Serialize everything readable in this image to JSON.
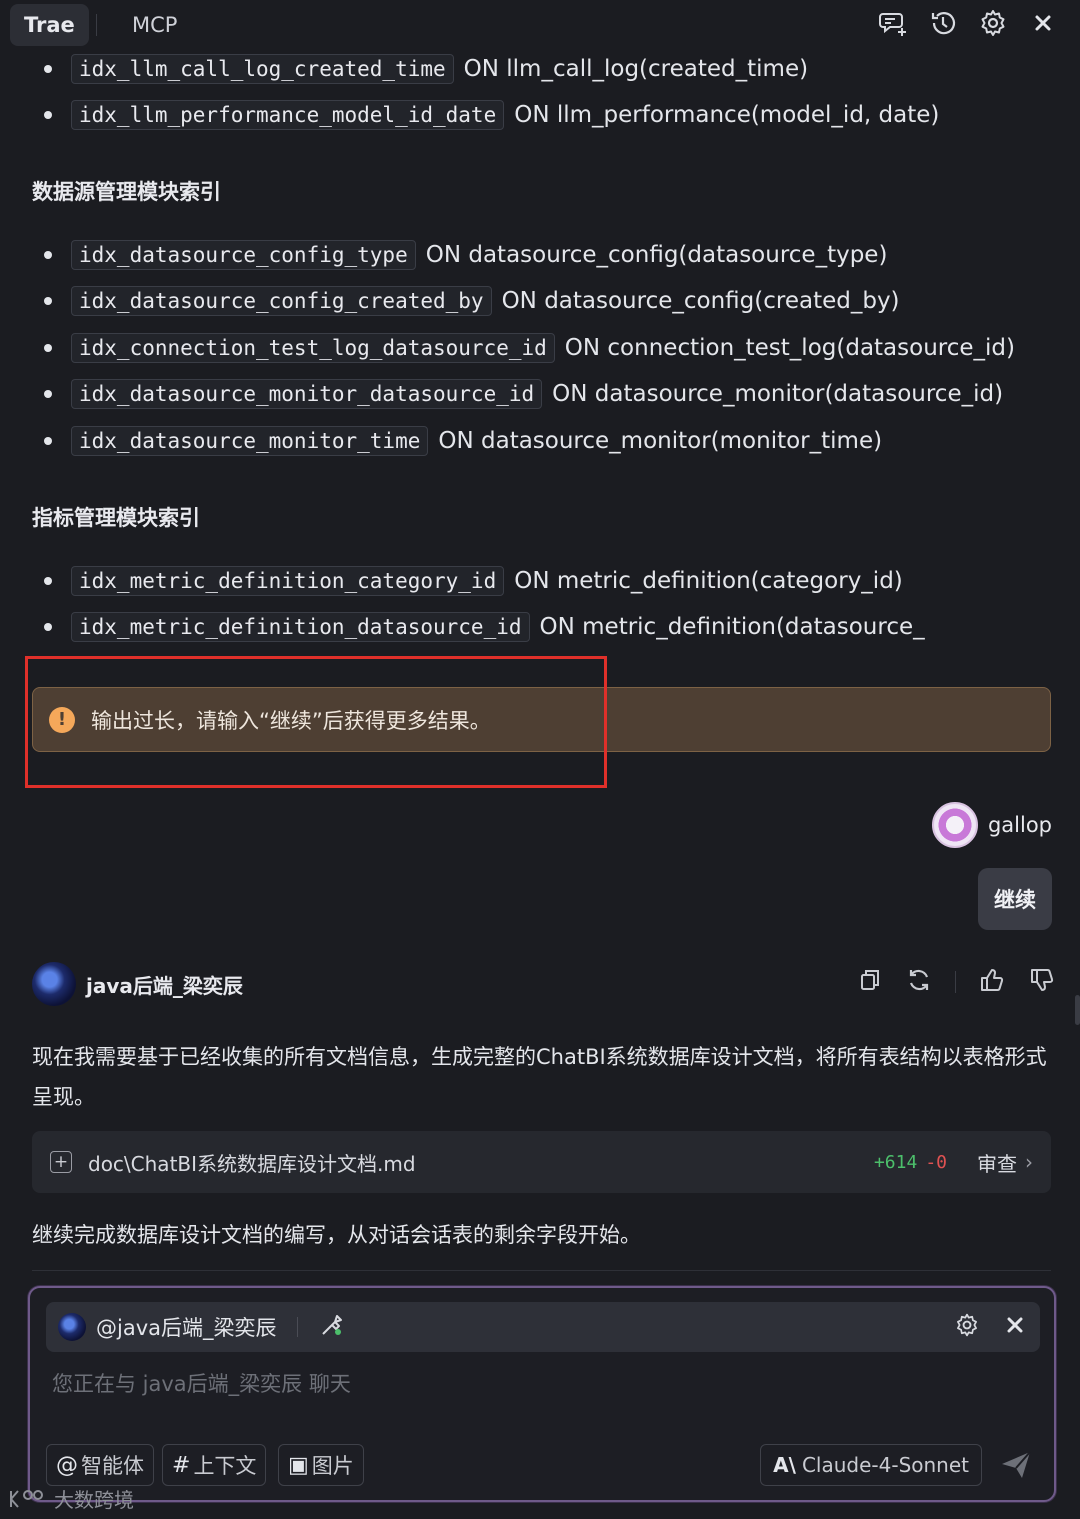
{
  "topbar": {
    "tabs": [
      "Trae",
      "MCP"
    ],
    "icons": [
      "new-chat-icon",
      "history-icon",
      "settings-icon",
      "close-icon"
    ]
  },
  "index_top": [
    {
      "code": "idx_llm_call_log_created_time",
      "text": "ON llm_call_log(created_time)"
    },
    {
      "code": "idx_llm_performance_model_id_date",
      "text": "ON llm_performance(model_id, date)"
    }
  ],
  "datasource": {
    "title": "数据源管理模块索引",
    "items": [
      {
        "code": "idx_datasource_config_type",
        "text": "ON datasource_config(datasource_type)"
      },
      {
        "code": "idx_datasource_config_created_by",
        "text": "ON datasource_config(created_by)"
      },
      {
        "code": "idx_connection_test_log_datasource_id",
        "text": "ON connection_test_log(datasource_id)"
      },
      {
        "code": "idx_datasource_monitor_datasource_id",
        "text": "ON datasource_monitor(datasource_id)"
      },
      {
        "code": "idx_datasource_monitor_time",
        "text": "ON datasource_monitor(monitor_time)"
      }
    ]
  },
  "metric": {
    "title": "指标管理模块索引",
    "items": [
      {
        "code": "idx_metric_definition_category_id",
        "text": "ON metric_definition(category_id)"
      },
      {
        "code": "idx_metric_definition_datasource_id",
        "text": "ON metric_definition(datasource_"
      }
    ]
  },
  "warning": {
    "icon": "!",
    "text": "输出过长，请输入“继续”后获得更多结果。"
  },
  "user": {
    "name": "gallop",
    "message": "继续"
  },
  "agent": {
    "name": "java后端_梁奕辰",
    "message": "现在我需要基于已经收集的所有文档信息，生成完整的ChatBI系统数据库设计文档，将所有表结构以表格形式呈现。",
    "file": {
      "name": "doc\\ChatBI系统数据库设计文档.md",
      "added": "+614",
      "removed": "-0",
      "review": "审查"
    },
    "followup": "继续完成数据库设计文档的编写，从对话会话表的剩余字段开始。"
  },
  "input": {
    "mention": "@java后端_梁奕辰",
    "placeholder": "您正在与 java后端_梁奕辰 聊天",
    "chips": [
      {
        "sym": "@",
        "label": "智能体"
      },
      {
        "sym": "#",
        "label": "上下文"
      },
      {
        "sym": "▣",
        "label": "图片"
      }
    ],
    "model": {
      "logo": "A\\",
      "name": "Claude-4-Sonnet"
    }
  },
  "watermark": "大数跨境"
}
